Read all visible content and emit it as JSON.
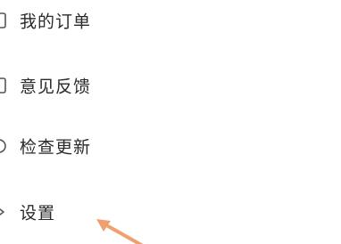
{
  "menu": {
    "items": [
      {
        "label": "我的订单",
        "icon": "clipboard-icon"
      },
      {
        "label": "意见反馈",
        "icon": "feedback-icon"
      },
      {
        "label": "检查更新",
        "icon": "refresh-icon"
      },
      {
        "label": "设置",
        "icon": "gear-icon"
      }
    ]
  },
  "annotation": {
    "arrow_color": "#f0a070"
  }
}
